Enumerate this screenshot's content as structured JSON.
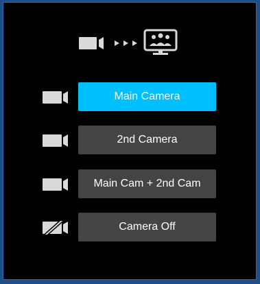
{
  "header": {
    "source_icon": "video-camera-icon",
    "transfer_icon": "triple-arrow-icon",
    "target_icon": "meeting-display-icon"
  },
  "options": [
    {
      "label": "Main Camera",
      "icon": "video-camera-icon",
      "selected": true
    },
    {
      "label": "2nd Camera",
      "icon": "video-camera-icon",
      "selected": false
    },
    {
      "label": "Main Cam + 2nd Cam",
      "icon": "video-camera-icon",
      "selected": false
    },
    {
      "label": "Camera Off",
      "icon": "video-camera-off-icon",
      "selected": false
    }
  ],
  "colors": {
    "selected": "#00bfff",
    "button": "#444444",
    "icon": "#d9d9d9",
    "background": "#000000",
    "border": "#2a6bb8"
  }
}
